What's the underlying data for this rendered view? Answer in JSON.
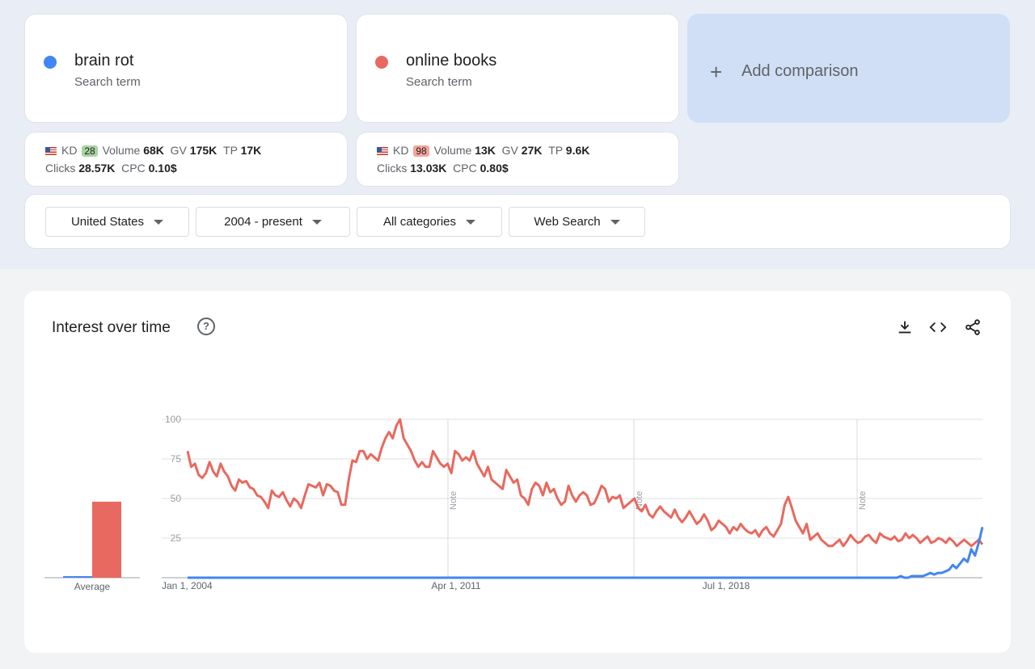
{
  "terms": [
    {
      "name": "brain rot",
      "sub": "Search term",
      "color": "#4285f4"
    },
    {
      "name": "online books",
      "sub": "Search term",
      "color": "#e8695f"
    }
  ],
  "add_comparison": "Add comparison",
  "metrics": [
    {
      "kd_label": "KD",
      "kd": "28",
      "kd_color": "#a8d5a2",
      "volume_label": "Volume",
      "volume": "68K",
      "gv_label": "GV",
      "gv": "175K",
      "tp_label": "TP",
      "tp": "17K",
      "clicks_label": "Clicks",
      "clicks": "28.57K",
      "cpc_label": "CPC",
      "cpc": "0.10$"
    },
    {
      "kd_label": "KD",
      "kd": "98",
      "kd_color": "#f4a59c",
      "volume_label": "Volume",
      "volume": "13K",
      "gv_label": "GV",
      "gv": "27K",
      "tp_label": "TP",
      "tp": "9.6K",
      "clicks_label": "Clicks",
      "clicks": "13.03K",
      "cpc_label": "CPC",
      "cpc": "0.80$"
    }
  ],
  "filters": {
    "region": "United States",
    "time": "2004 - present",
    "category": "All categories",
    "search_type": "Web Search"
  },
  "chart_title": "Interest over time",
  "toolbar_icons": [
    "download-icon",
    "embed-code-icon",
    "share-icon"
  ],
  "chart_data": {
    "type": "line",
    "title": "Interest over time",
    "x_ticks": [
      "Jan 1, 2004",
      "Apr 1, 2011",
      "Jul 1, 2018"
    ],
    "y_ticks": [
      100,
      75,
      50,
      25
    ],
    "ylim": [
      0,
      100
    ],
    "notes": [
      "Note",
      "Note",
      "Note"
    ],
    "average": {
      "label": "Average",
      "series": [
        {
          "name": "brain rot",
          "value": 1
        },
        {
          "name": "online books",
          "value": 48
        }
      ]
    },
    "series": [
      {
        "name": "online books",
        "color": "#e8695f",
        "values": [
          80,
          70,
          72,
          65,
          63,
          66,
          73,
          67,
          64,
          72,
          67,
          64,
          58,
          55,
          62,
          60,
          61,
          57,
          56,
          52,
          51,
          48,
          44,
          55,
          52,
          51,
          54,
          49,
          45,
          50,
          48,
          44,
          52,
          59,
          58,
          57,
          60,
          52,
          59,
          58,
          55,
          54,
          46,
          46,
          62,
          74,
          73,
          80,
          80,
          75,
          78,
          76,
          74,
          82,
          88,
          92,
          88,
          96,
          100,
          88,
          84,
          80,
          74,
          70,
          73,
          70,
          70,
          80,
          76,
          72,
          70,
          72,
          66,
          80,
          78,
          74,
          76,
          74,
          80,
          72,
          68,
          64,
          70,
          62,
          60,
          58,
          56,
          68,
          64,
          60,
          62,
          52,
          50,
          46,
          56,
          60,
          58,
          52,
          60,
          54,
          56,
          50,
          46,
          48,
          58,
          52,
          48,
          52,
          54,
          52,
          46,
          47,
          52,
          58,
          56,
          48,
          51,
          50,
          52,
          44,
          46,
          48,
          50,
          44,
          42,
          46,
          40,
          38,
          42,
          45,
          42,
          40,
          38,
          43,
          38,
          35,
          38,
          42,
          38,
          34,
          36,
          40,
          36,
          30,
          32,
          36,
          34,
          32,
          28,
          32,
          30,
          34,
          31,
          29,
          28,
          30,
          26,
          30,
          32,
          28,
          26,
          30,
          34,
          46,
          51,
          44,
          36,
          32,
          28,
          34,
          24,
          26,
          28,
          24,
          22,
          20,
          20,
          22,
          24,
          20,
          23,
          27,
          24,
          22,
          23,
          26,
          27,
          24,
          22,
          28,
          26,
          25,
          24,
          26,
          23,
          24,
          28,
          25,
          27,
          25,
          22,
          24,
          26,
          22,
          23,
          25,
          24,
          22,
          25,
          23,
          20,
          22,
          24,
          22,
          20,
          22,
          24,
          21
        ]
      },
      {
        "name": "brain rot",
        "color": "#4285f4",
        "values": [
          0,
          0,
          0,
          0,
          0,
          0,
          0,
          0,
          0,
          0,
          0,
          0,
          0,
          0,
          0,
          0,
          0,
          0,
          0,
          0,
          0,
          0,
          0,
          0,
          0,
          0,
          0,
          0,
          0,
          0,
          0,
          0,
          0,
          0,
          0,
          0,
          0,
          0,
          0,
          0,
          0,
          0,
          0,
          0,
          0,
          0,
          0,
          0,
          0,
          0,
          0,
          0,
          0,
          0,
          0,
          0,
          0,
          0,
          0,
          0,
          0,
          0,
          0,
          0,
          0,
          0,
          0,
          0,
          0,
          0,
          0,
          0,
          0,
          0,
          0,
          0,
          0,
          0,
          0,
          0,
          0,
          0,
          0,
          0,
          0,
          0,
          0,
          0,
          0,
          0,
          0,
          0,
          0,
          0,
          0,
          0,
          0,
          0,
          0,
          0,
          0,
          0,
          0,
          0,
          0,
          0,
          0,
          0,
          0,
          0,
          0,
          0,
          0,
          0,
          0,
          0,
          0,
          0,
          0,
          0,
          0,
          0,
          0,
          0,
          0,
          0,
          0,
          0,
          0,
          0,
          0,
          0,
          0,
          0,
          0,
          0,
          0,
          0,
          0,
          0,
          0,
          0,
          0,
          0,
          0,
          0,
          0,
          0,
          0,
          0,
          0,
          0,
          0,
          0,
          0,
          0,
          0,
          0,
          0,
          0,
          0,
          0,
          0,
          0,
          0,
          0,
          0,
          0,
          0,
          0,
          0,
          0,
          0,
          0,
          0,
          0,
          0,
          0,
          0,
          0,
          0,
          0,
          0,
          0,
          0,
          0,
          0,
          0,
          0,
          0,
          0,
          0,
          1,
          0,
          0,
          1,
          1,
          1,
          1,
          2,
          3,
          2,
          3,
          3,
          4,
          5,
          8,
          6,
          9,
          12,
          10,
          18,
          14,
          22,
          32
        ]
      }
    ]
  }
}
